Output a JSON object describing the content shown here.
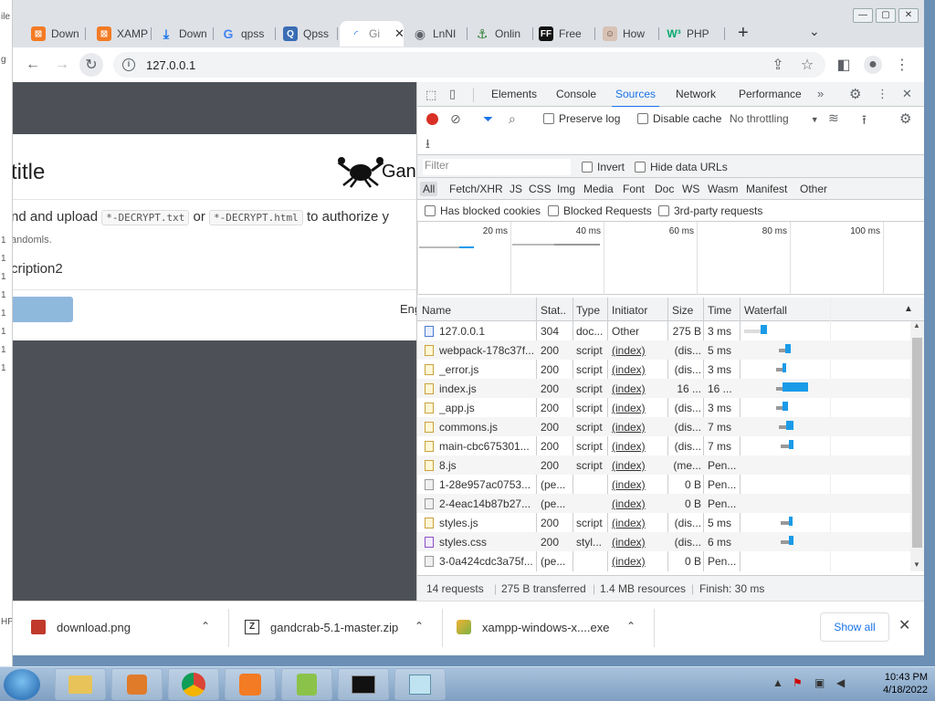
{
  "desktop_left_labels": [
    "ile",
    "g",
    "",
    "",
    "",
    "",
    "1",
    "1",
    "1",
    "1",
    "1",
    "1",
    "1",
    "1",
    "HP"
  ],
  "tabs": [
    {
      "label": "Down",
      "icon": "xampp-icon",
      "color": "#f37b24"
    },
    {
      "label": "XAMP",
      "icon": "xampp-icon",
      "color": "#f37b24"
    },
    {
      "label": "Down",
      "icon": "download-icon",
      "color": "#1a73e8"
    },
    {
      "label": "qpss",
      "icon": "google-icon",
      "color": "#4285f4"
    },
    {
      "label": "Qpss",
      "icon": "qpss-icon",
      "color": "#d06c2a"
    },
    {
      "label": "Gi",
      "icon": "loading-icon",
      "color": "#1a73e8"
    },
    {
      "label": "LnNI",
      "icon": "globe-icon",
      "color": "#5f6368"
    },
    {
      "label": "Onlin",
      "icon": "anchor-icon",
      "color": "#2e7d32"
    },
    {
      "label": "Free",
      "icon": "ff-icon",
      "color": "#111111"
    },
    {
      "label": "How",
      "icon": "face-icon",
      "color": "#a1887f"
    },
    {
      "label": "PHP",
      "icon": "w3-icon",
      "color": "#04aa6d"
    }
  ],
  "window_controls": {
    "minimize": "—",
    "maximize": "▢",
    "close": "✕"
  },
  "toolbar": {
    "url": "127.0.0.1"
  },
  "page": {
    "title": "title",
    "brand": "Gan",
    "instruction_pre": "nd and upload",
    "code1": "*-DECRYPT.txt",
    "or": "or",
    "code2": "*-DECRYPT.html",
    "instruction_post": "to authorize y",
    "small": "andomls.",
    "desc2": "cription2",
    "eng": "Eng"
  },
  "devtools": {
    "tabs": [
      "Elements",
      "Console",
      "Sources",
      "Network",
      "Performance"
    ],
    "active_tab": "Sources",
    "preserve_log": "Preserve log",
    "disable_cache": "Disable cache",
    "throttling": "No throttling",
    "filter_placeholder": "Filter",
    "invert": "Invert",
    "hide_data_urls": "Hide data URLs",
    "types": [
      "All",
      "Fetch/XHR",
      "JS",
      "CSS",
      "Img",
      "Media",
      "Font",
      "Doc",
      "WS",
      "Wasm",
      "Manifest",
      "Other"
    ],
    "blocked_cookies": "Has blocked cookies",
    "blocked_requests": "Blocked Requests",
    "third_party": "3rd-party requests",
    "ticks": [
      "20 ms",
      "40 ms",
      "60 ms",
      "80 ms",
      "100 ms"
    ],
    "columns": [
      "Name",
      "Stat..",
      "Type",
      "Initiator",
      "Size",
      "Time",
      "Waterfall"
    ],
    "rows": [
      {
        "name": "127.0.0.1",
        "status": "304",
        "type": "doc...",
        "initiator": "Other",
        "size": "275 B",
        "time": "3 ms",
        "icon": "doc",
        "wf_start": 0.0,
        "wf_wait": 0.2,
        "wf_recv": 0.07
      },
      {
        "name": "webpack-178c37f...",
        "status": "200",
        "type": "script",
        "initiator": "(index)",
        "size": "(dis...",
        "time": "5 ms",
        "icon": "js",
        "wf_start": 0.41,
        "wf_wait": 0.08,
        "wf_recv": 0.06
      },
      {
        "name": "_error.js",
        "status": "200",
        "type": "script",
        "initiator": "(index)",
        "size": "(dis...",
        "time": "3 ms",
        "icon": "js",
        "wf_start": 0.38,
        "wf_wait": 0.08,
        "wf_recv": 0.04
      },
      {
        "name": "index.js",
        "status": "200",
        "type": "script",
        "initiator": "(index)",
        "size": "16 ...",
        "time": "16 ...",
        "icon": "js",
        "wf_start": 0.38,
        "wf_wait": 0.08,
        "wf_recv": 0.3
      },
      {
        "name": "_app.js",
        "status": "200",
        "type": "script",
        "initiator": "(index)",
        "size": "(dis...",
        "time": "3 ms",
        "icon": "js",
        "wf_start": 0.38,
        "wf_wait": 0.08,
        "wf_recv": 0.06
      },
      {
        "name": "commons.js",
        "status": "200",
        "type": "script",
        "initiator": "(index)",
        "size": "(dis...",
        "time": "7 ms",
        "icon": "js",
        "wf_start": 0.41,
        "wf_wait": 0.09,
        "wf_recv": 0.09
      },
      {
        "name": "main-cbc675301...",
        "status": "200",
        "type": "script",
        "initiator": "(index)",
        "size": "(dis...",
        "time": "7 ms",
        "icon": "js",
        "wf_start": 0.44,
        "wf_wait": 0.09,
        "wf_recv": 0.06
      },
      {
        "name": "8.js",
        "status": "200",
        "type": "script",
        "initiator": "(index)",
        "size": "(me...",
        "time": "Pen...",
        "icon": "js",
        "wf_start": 0,
        "wf_wait": 0,
        "wf_recv": 0
      },
      {
        "name": "1-28e957ac0753...",
        "status": "(pe...",
        "type": "",
        "initiator": "(index)",
        "size": "0 B",
        "time": "Pen...",
        "icon": "gray",
        "wf_start": 0,
        "wf_wait": 0,
        "wf_recv": 0
      },
      {
        "name": "2-4eac14b87b27...",
        "status": "(pe...",
        "type": "",
        "initiator": "(index)",
        "size": "0 B",
        "time": "Pen...",
        "icon": "gray",
        "wf_start": 0,
        "wf_wait": 0,
        "wf_recv": 0
      },
      {
        "name": "styles.js",
        "status": "200",
        "type": "script",
        "initiator": "(index)",
        "size": "(dis...",
        "time": "5 ms",
        "icon": "js",
        "wf_start": 0.44,
        "wf_wait": 0.09,
        "wf_recv": 0.05
      },
      {
        "name": "styles.css",
        "status": "200",
        "type": "styl...",
        "initiator": "(index)",
        "size": "(dis...",
        "time": "6 ms",
        "icon": "css",
        "wf_start": 0.44,
        "wf_wait": 0.09,
        "wf_recv": 0.06
      },
      {
        "name": "3-0a424cdc3a75f...",
        "status": "(pe...",
        "type": "",
        "initiator": "(index)",
        "size": "0 B",
        "time": "Pen...",
        "icon": "gray",
        "wf_start": 0,
        "wf_wait": 0,
        "wf_recv": 0
      }
    ],
    "status": {
      "requests": "14 requests",
      "transferred": "275 B transferred",
      "resources": "1.4 MB resources",
      "finish": "Finish: 30 ms"
    }
  },
  "downloads": [
    {
      "name": "download.png",
      "icon": "image-icon"
    },
    {
      "name": "gandcrab-5.1-master.zip",
      "icon": "zip-icon"
    },
    {
      "name": "xampp-windows-x....exe",
      "icon": "installer-icon"
    }
  ],
  "show_all": "Show all",
  "taskbar": {
    "time": "10:43 PM",
    "date": "4/18/2022"
  },
  "colors": {
    "accent": "#1a73e8",
    "waterfall": "#1a9be8",
    "record": "#d93025"
  }
}
